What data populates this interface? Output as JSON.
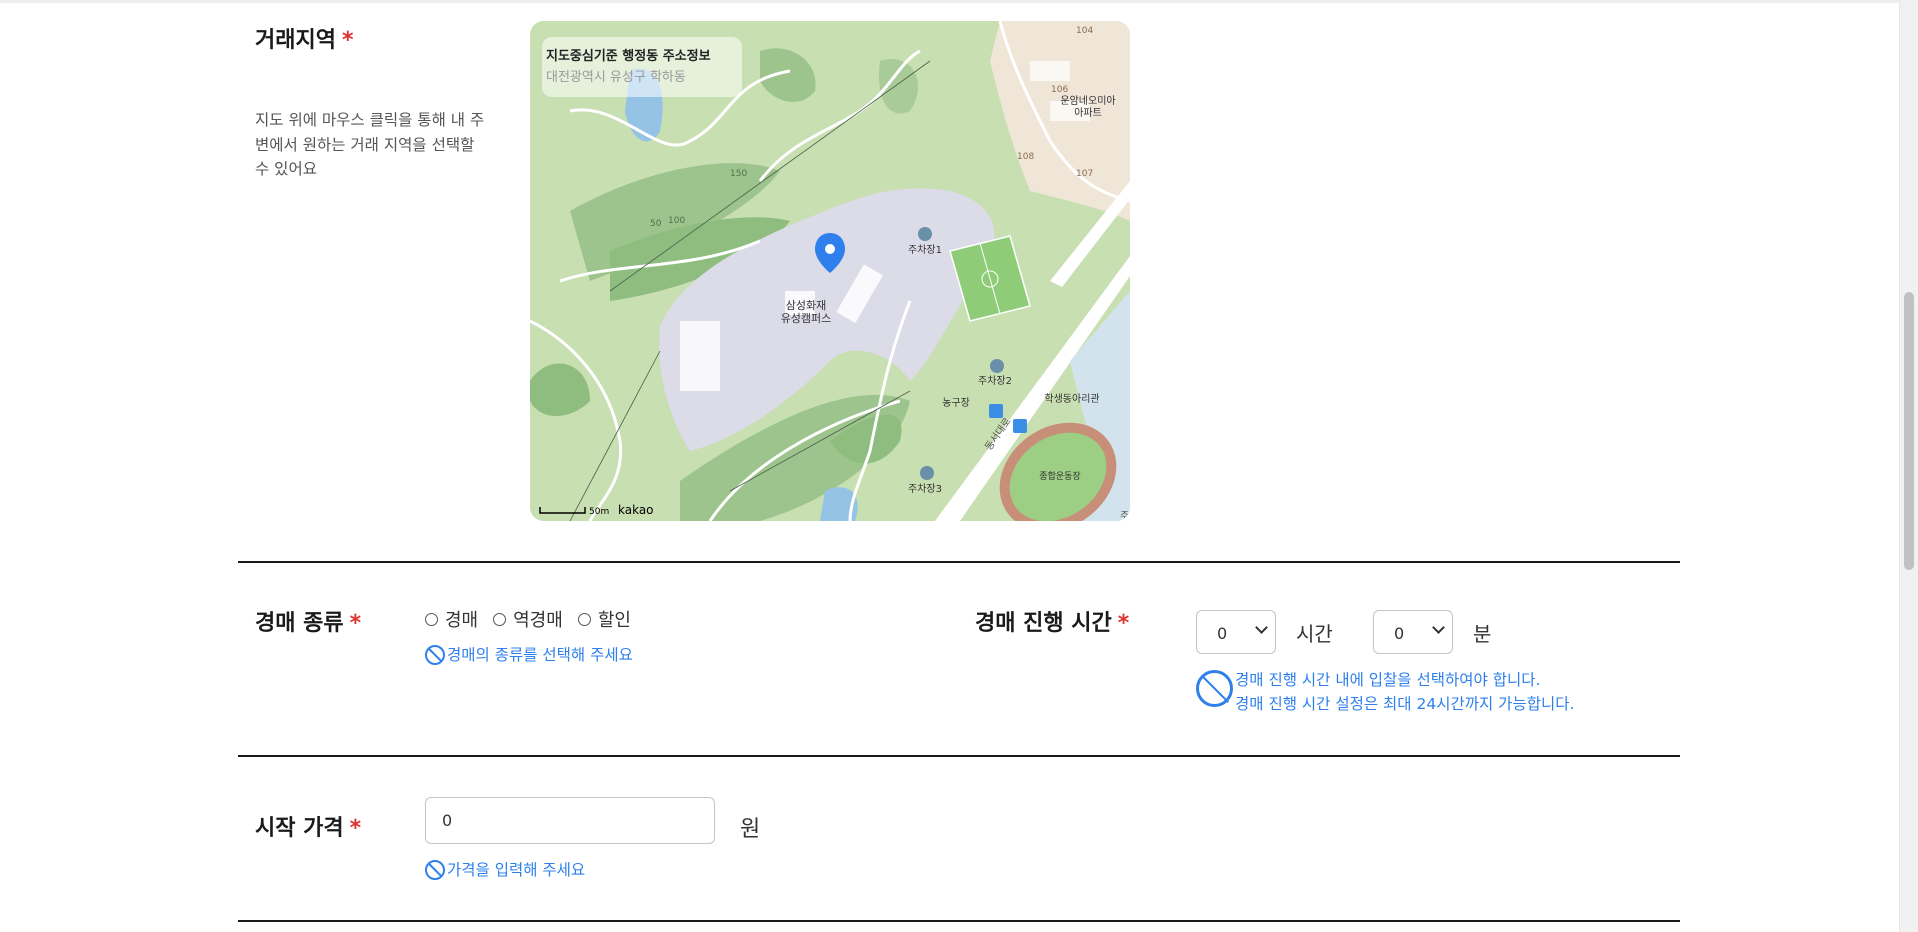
{
  "region": {
    "label": "거래지역",
    "required_mark": "*",
    "description": "지도 위에 마우스 클릭을 통해 내 주변에서 원하는 거래 지역을 선택할 수 있어요",
    "map": {
      "info_title": "지도중심기준 행정동 주소정보",
      "info_address": "대전광역시 유성구 학하동",
      "labels": {
        "poi": "삼성화재\n유성캠퍼스",
        "apt": "운암네오미아\n아파트",
        "p1": "주차장1",
        "p2": "주차장2",
        "p3": "주차장3",
        "court": "농구장",
        "club": "학생동아리관",
        "stadium": "종합운동장",
        "road": "동서대로",
        "b104": "104",
        "b106": "106",
        "b108": "108",
        "b107": "107",
        "scale": "50m",
        "brand": "kakao",
        "c50": "50",
        "c100": "100",
        "c150": "150",
        "edge": "주"
      }
    }
  },
  "auction_type": {
    "label": "경매 종류",
    "required_mark": "*",
    "options": [
      "경매",
      "역경매",
      "할인"
    ],
    "hint": "경매의 종류를 선택해 주세요"
  },
  "auction_duration": {
    "label": "경매 진행 시간",
    "required_mark": "*",
    "hours_value": "0",
    "hours_unit": "시간",
    "minutes_value": "0",
    "minutes_unit": "분",
    "hint_line1": "경매 진행 시간 내에 입찰을 선택하여야 합니다.",
    "hint_line2": "경매 진행 시간 설정은 최대 24시간까지 가능합니다."
  },
  "start_price": {
    "label": "시작 가격",
    "required_mark": "*",
    "value": "0",
    "unit": "원",
    "hint": "가격을 입력해 주세요"
  },
  "colors": {
    "accent": "#2f80ed",
    "required": "#e03131",
    "map_green": "#c8dfb2",
    "map_campus": "#dcdbe8"
  }
}
